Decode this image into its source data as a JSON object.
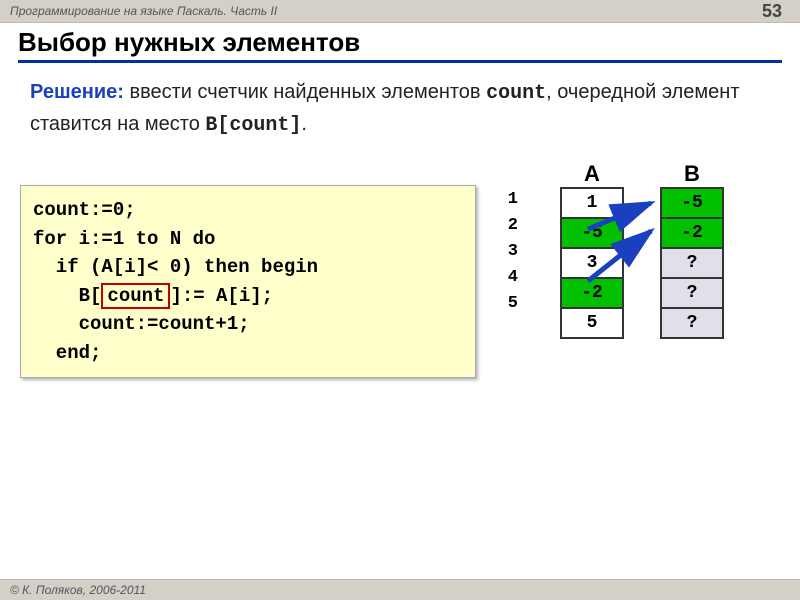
{
  "header": {
    "course": "Программирование на языке Паскаль. Часть II",
    "page": "53"
  },
  "title": "Выбор нужных элементов",
  "description": {
    "solution_label": "Решение:",
    "part1": " ввести счетчик найденных элементов ",
    "count": "count",
    "part2": ", очередной элемент ставится на место ",
    "bcount": "B[count]",
    "part3": "."
  },
  "code": {
    "l1": "count:=0;",
    "l2": "for i:=1 to N do",
    "l3a": "  if (A[i]",
    "l3lt": "<",
    "l3b": "0) then begin",
    "l4a": "    B[",
    "l4boxed": "count",
    "l4b": "]:= A[i];",
    "l5": "    count:=count+1;",
    "l6": "  end;"
  },
  "arrays": {
    "indices": [
      "1",
      "2",
      "3",
      "4",
      "5"
    ],
    "A": {
      "label": "A",
      "cells": [
        {
          "v": "1",
          "cls": ""
        },
        {
          "v": "-5",
          "cls": "green"
        },
        {
          "v": "3",
          "cls": ""
        },
        {
          "v": "-2",
          "cls": "green"
        },
        {
          "v": "5",
          "cls": ""
        }
      ]
    },
    "B": {
      "label": "B",
      "cells": [
        {
          "v": "-5",
          "cls": "greenB"
        },
        {
          "v": "-2",
          "cls": "greenB"
        },
        {
          "v": "?",
          "cls": "grey"
        },
        {
          "v": "?",
          "cls": "grey"
        },
        {
          "v": "?",
          "cls": "grey"
        }
      ]
    }
  },
  "footer": "© К. Поляков, 2006-2011"
}
